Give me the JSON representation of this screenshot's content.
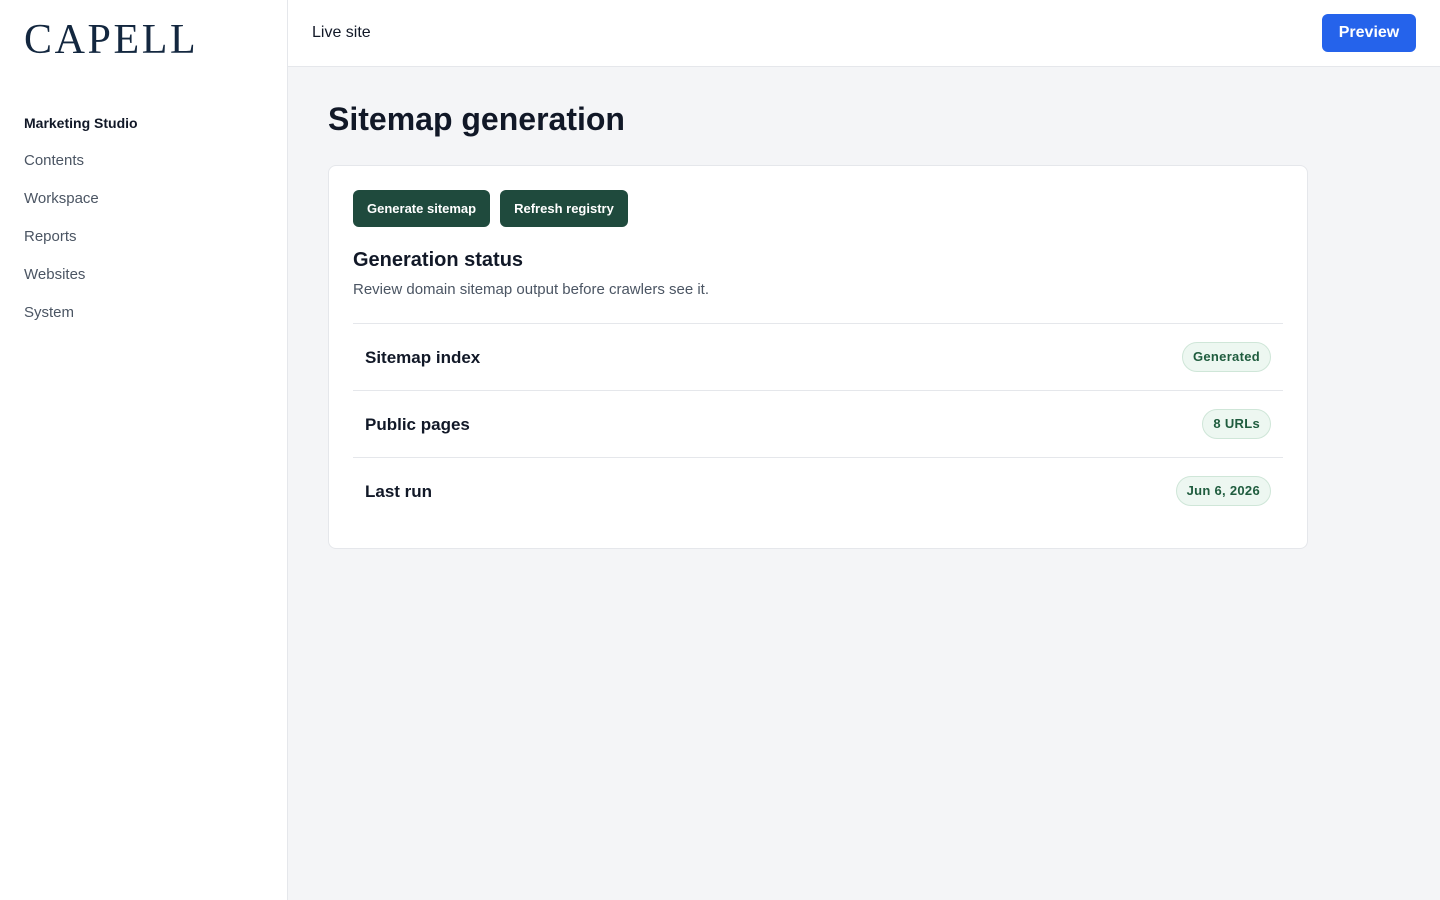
{
  "brand": {
    "logo_text": "CAPELL"
  },
  "sidebar": {
    "items": [
      {
        "label": "Marketing Studio",
        "active": true
      },
      {
        "label": "Contents"
      },
      {
        "label": "Workspace"
      },
      {
        "label": "Reports"
      },
      {
        "label": "Websites"
      },
      {
        "label": "System"
      }
    ]
  },
  "topbar": {
    "live_site": "Live site",
    "preview_label": "Preview"
  },
  "main": {
    "title": "Sitemap generation",
    "actions": {
      "generate_label": "Generate sitemap",
      "refresh_label": "Refresh registry"
    },
    "section_title": "Generation status",
    "section_desc": "Review domain sitemap output before crawlers see it.",
    "rows": [
      {
        "label": "Sitemap index",
        "value": "Generated"
      },
      {
        "label": "Public pages",
        "value": "8 URLs"
      },
      {
        "label": "Last run",
        "value": "Jun 6, 2026"
      }
    ]
  },
  "colors": {
    "accent": "#2563eb",
    "action": "#1f4a3d",
    "badge_bg": "#edf7f1",
    "badge_text": "#1f5c3e"
  }
}
